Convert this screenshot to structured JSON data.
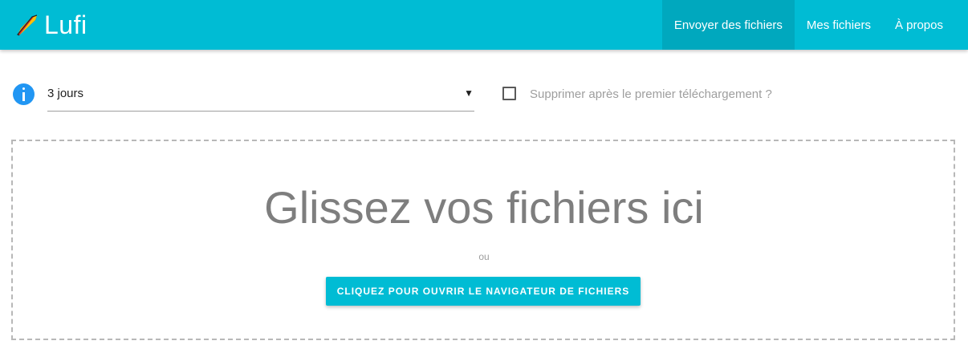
{
  "header": {
    "brand": "Lufi",
    "logo_icon": "lufi-logo-icon",
    "bar_color": "#00bcd4",
    "nav": [
      {
        "label": "Envoyer des fichiers",
        "active": true
      },
      {
        "label": "Mes fichiers",
        "active": false
      },
      {
        "label": "À propos",
        "active": false
      }
    ]
  },
  "form": {
    "info_icon": "info-icon",
    "delay": {
      "selected": "3 jours",
      "caret": "▾"
    },
    "delete_after_download": {
      "label": "Supprimer après le premier téléchargement ?",
      "checked": false
    }
  },
  "dropzone": {
    "title": "Glissez vos fichiers ici",
    "or": "ou",
    "button": "CLIQUEZ POUR OUVRIR LE NAVIGATEUR DE FICHIERS"
  }
}
